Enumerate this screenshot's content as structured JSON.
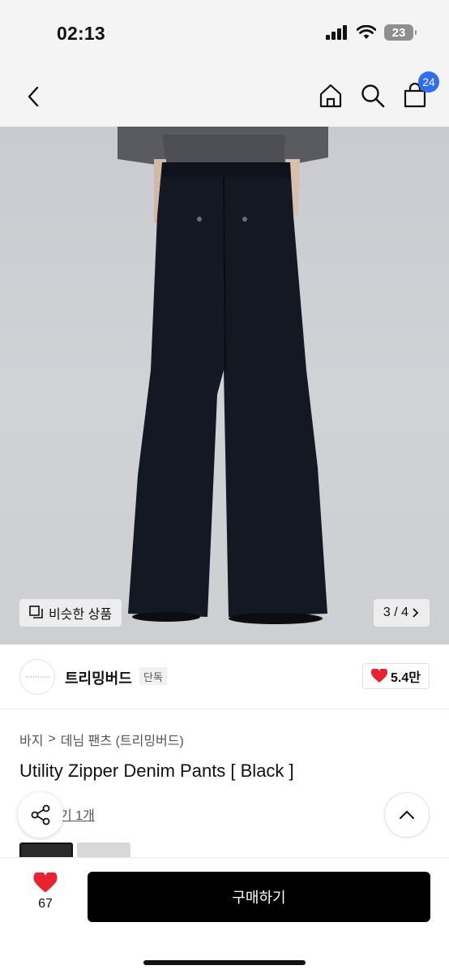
{
  "status_bar": {
    "time": "02:13",
    "battery": "23"
  },
  "header": {
    "cart_badge": "24",
    "icons": [
      "back-icon",
      "home-icon",
      "search-icon",
      "cart-icon"
    ]
  },
  "image": {
    "similar_label": "비슷한 상품",
    "page_indicator": "3 / 4"
  },
  "brand": {
    "name": "트리밍버드",
    "badge": "단독",
    "likes": "5.4만"
  },
  "breadcrumb": {
    "category": "바지",
    "separator": ">",
    "subcategory": "데님 팬츠 (트리밍버드)"
  },
  "product": {
    "title": "Utility Zipper Denim Pants [ Black ]",
    "review_text": "기 1개"
  },
  "bottom": {
    "wish_count": "67",
    "buy_label": "구매하기"
  },
  "colors": {
    "accent": "#2e6ef5",
    "heart": "#e8222f",
    "buy_button": "#000000"
  }
}
